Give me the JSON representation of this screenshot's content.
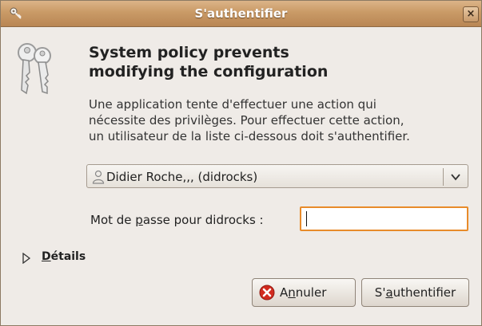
{
  "window": {
    "title": "S'authentifier",
    "close_glyph": "×",
    "title_icon": "key-icon"
  },
  "dialog": {
    "heading_line1": "System policy prevents",
    "heading_line2": "modifying the configuration",
    "message_line1": "Une application tente d'effectuer une action qui",
    "message_line2": "nécessite des privilèges. Pour effectuer cette action,",
    "message_line3": "un utilisateur de la liste ci-dessous doit s'authentifier.",
    "user_select_value": "Didier Roche,,, (didrocks)",
    "password_label_pre": "Mot de ",
    "password_label_mnemonic": "p",
    "password_label_post": "asse pour didrocks :",
    "password_value": "",
    "details_mnemonic": "D",
    "details_rest": "étails",
    "cancel_pre": "A",
    "cancel_mnemonic": "n",
    "cancel_post": "nuler",
    "auth_pre": "S'",
    "auth_mnemonic": "a",
    "auth_post": "uthentifier"
  },
  "colors": {
    "titlebar": "#c99a66",
    "focus_border": "#e88b2a",
    "cancel_icon": "#d22b1f"
  }
}
